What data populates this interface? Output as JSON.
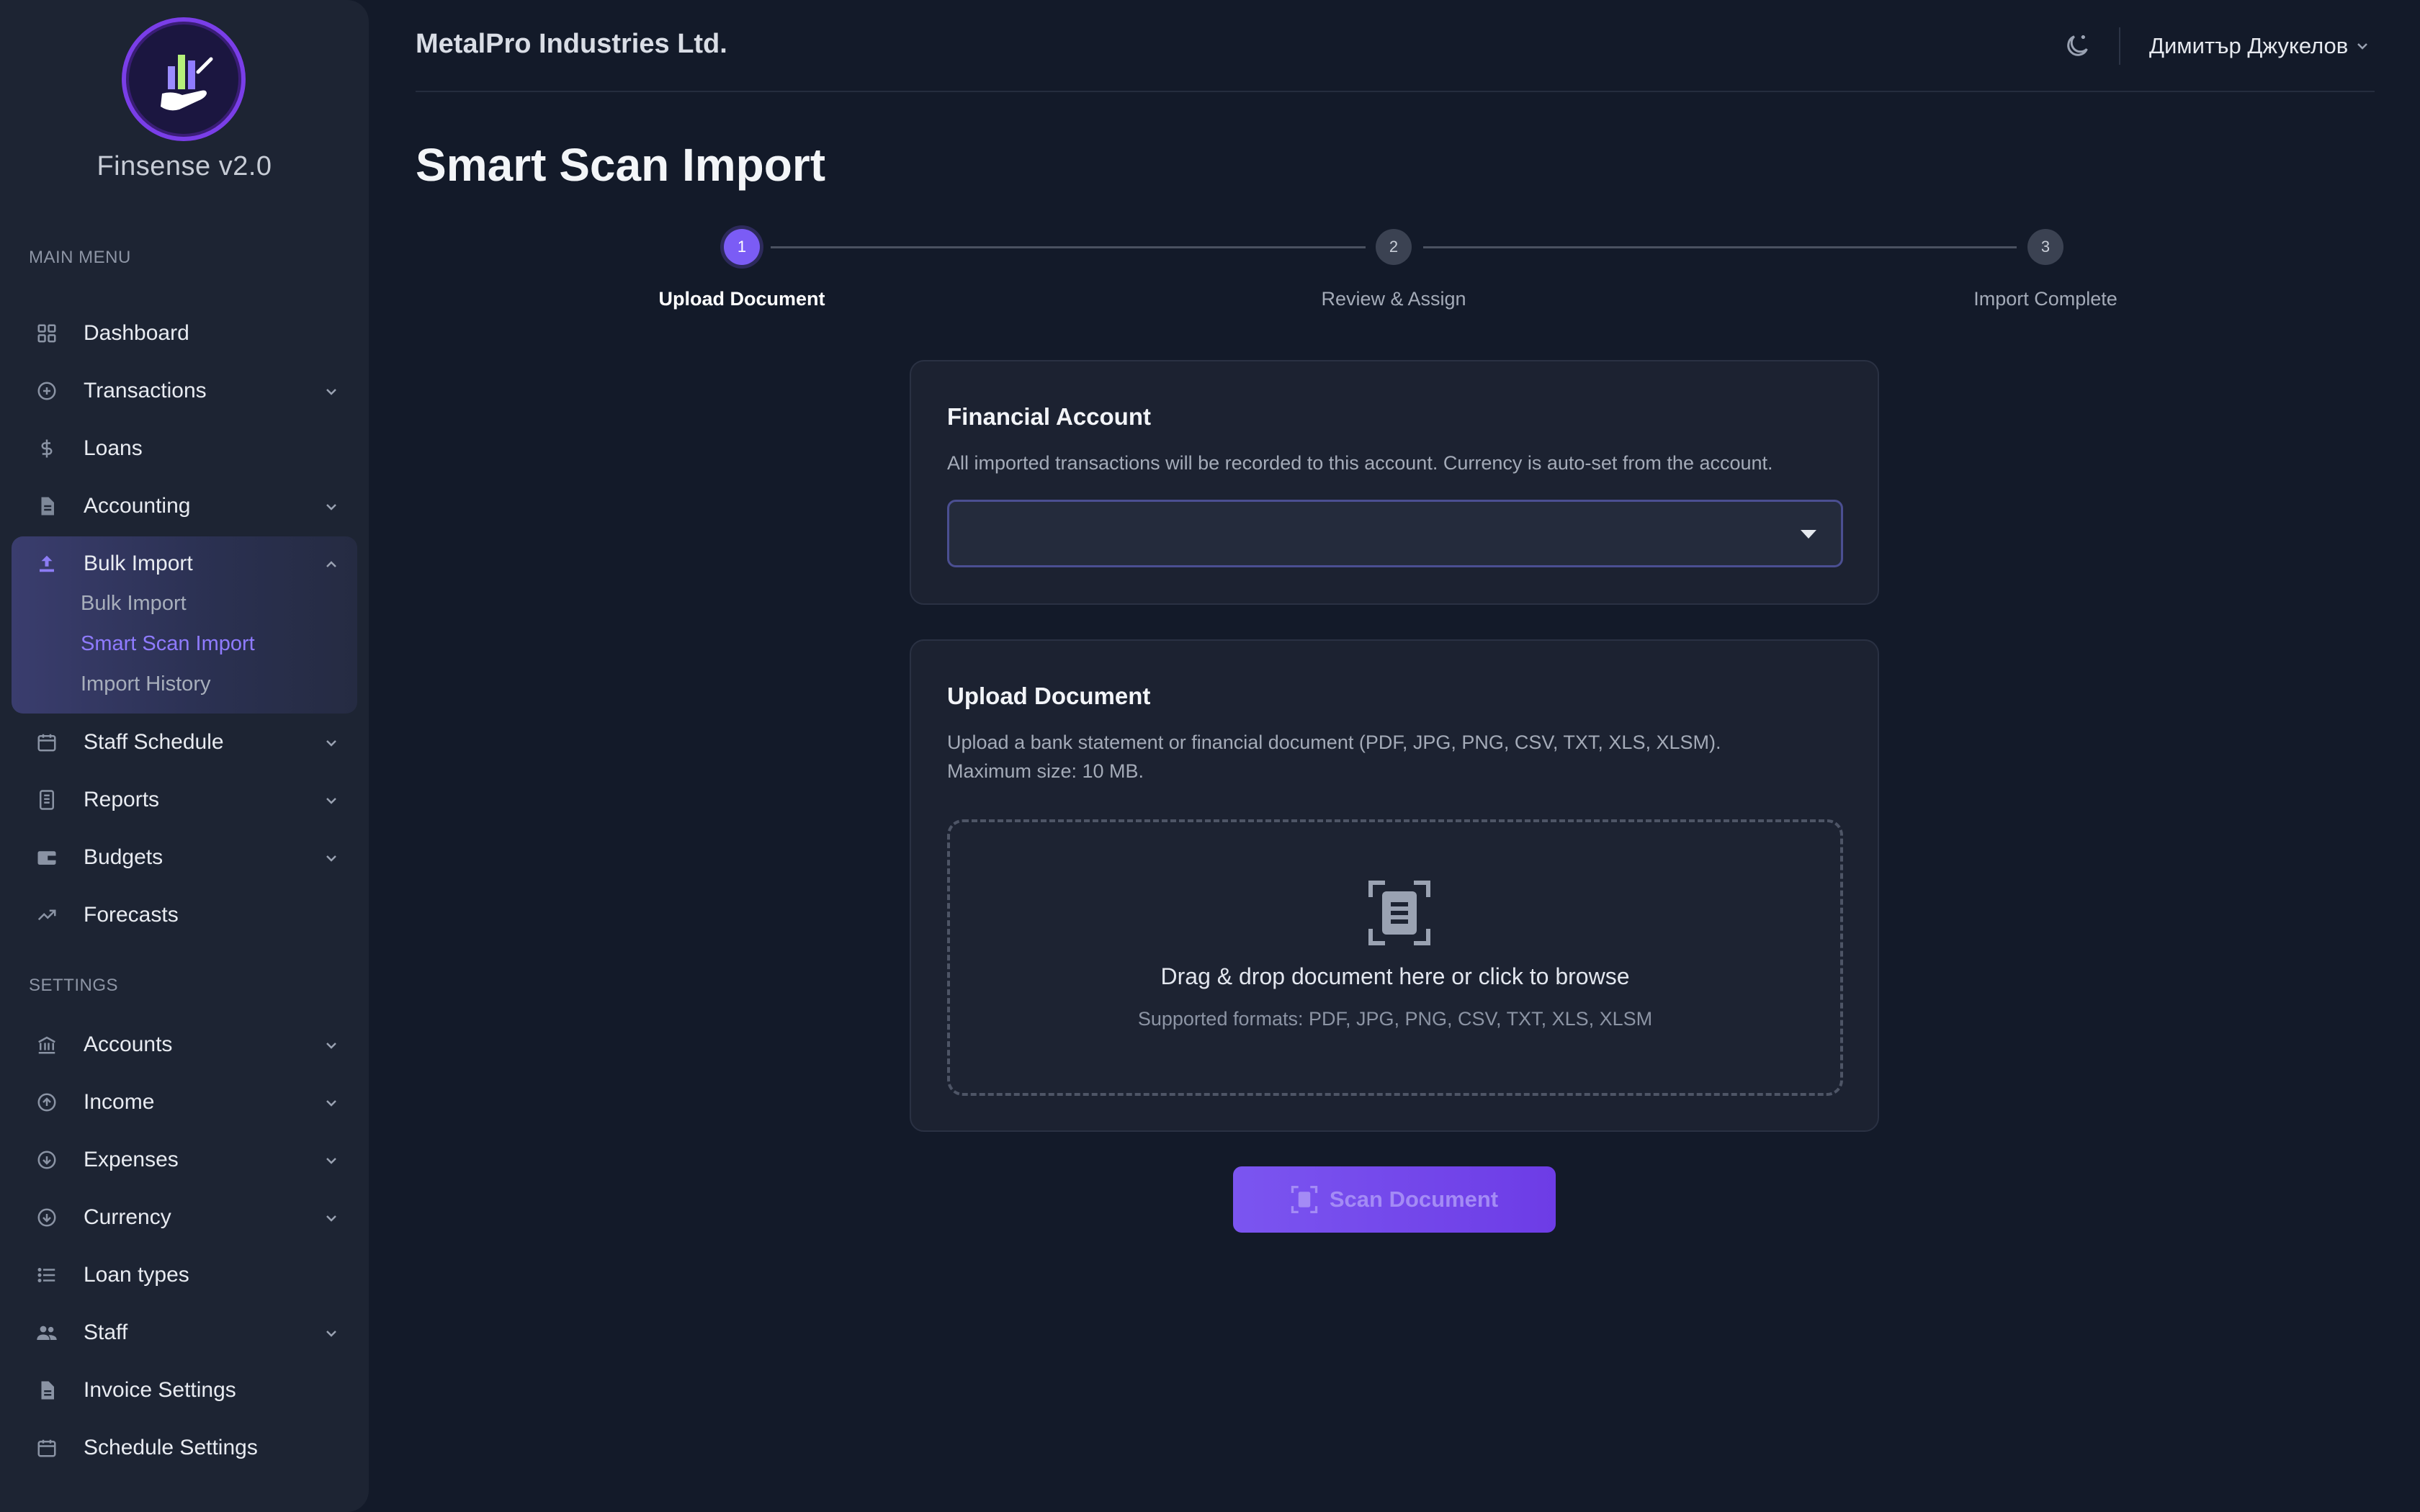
{
  "app": {
    "brand": "Finsense v2.0"
  },
  "header": {
    "company": "MetalPro Industries Ltd.",
    "user_name": "Димитър Джукелов"
  },
  "sidebar": {
    "main_menu_label": "MAIN MENU",
    "settings_label": "SETTINGS",
    "main_items": [
      {
        "label": "Dashboard",
        "icon": "grid-icon"
      },
      {
        "label": "Transactions",
        "icon": "plus-circle-icon"
      },
      {
        "label": "Loans",
        "icon": "dollar-icon"
      },
      {
        "label": "Accounting",
        "icon": "document-icon"
      },
      {
        "label": "Bulk Import",
        "icon": "upload-icon"
      },
      {
        "label": "Staff Schedule",
        "icon": "calendar-icon"
      },
      {
        "label": "Reports",
        "icon": "report-icon"
      },
      {
        "label": "Budgets",
        "icon": "wallet-icon"
      },
      {
        "label": "Forecasts",
        "icon": "trending-up-icon"
      }
    ],
    "bulk_import_sub": [
      {
        "label": "Bulk Import"
      },
      {
        "label": "Smart Scan Import"
      },
      {
        "label": "Import History"
      }
    ],
    "settings_items": [
      {
        "label": "Accounts",
        "icon": "bank-icon"
      },
      {
        "label": "Income",
        "icon": "arrow-up-circle-icon"
      },
      {
        "label": "Expenses",
        "icon": "arrow-down-circle-icon"
      },
      {
        "label": "Currency",
        "icon": "currency-circle-icon"
      },
      {
        "label": "Loan types",
        "icon": "list-icon"
      },
      {
        "label": "Staff",
        "icon": "people-icon"
      },
      {
        "label": "Invoice Settings",
        "icon": "invoice-icon"
      },
      {
        "label": "Schedule Settings",
        "icon": "calendar-icon"
      }
    ]
  },
  "page": {
    "title": "Smart Scan Import"
  },
  "stepper": {
    "steps": [
      {
        "number": "1",
        "label": "Upload Document"
      },
      {
        "number": "2",
        "label": "Review & Assign"
      },
      {
        "number": "3",
        "label": "Import Complete"
      }
    ],
    "current_step": 1
  },
  "account_card": {
    "title": "Financial Account",
    "description": "All imported transactions will be recorded to this account. Currency is auto-set from the account.",
    "selected_value": ""
  },
  "upload_card": {
    "title": "Upload Document",
    "description_line1": "Upload a bank statement or financial document (PDF, JPG, PNG, CSV, TXT, XLS, XLSM).",
    "description_line2": "Maximum size: 10 MB.",
    "dropzone_text": "Drag & drop document here or click to browse",
    "dropzone_formats": "Supported formats: PDF, JPG, PNG, CSV, TXT, XLS, XLSM"
  },
  "scan_button": {
    "label": "Scan Document"
  },
  "colors": {
    "accent": "#7b5cf5",
    "background": "#131a29",
    "sidebar": "#1d2433",
    "active_sub_item": "#8f7bff"
  }
}
